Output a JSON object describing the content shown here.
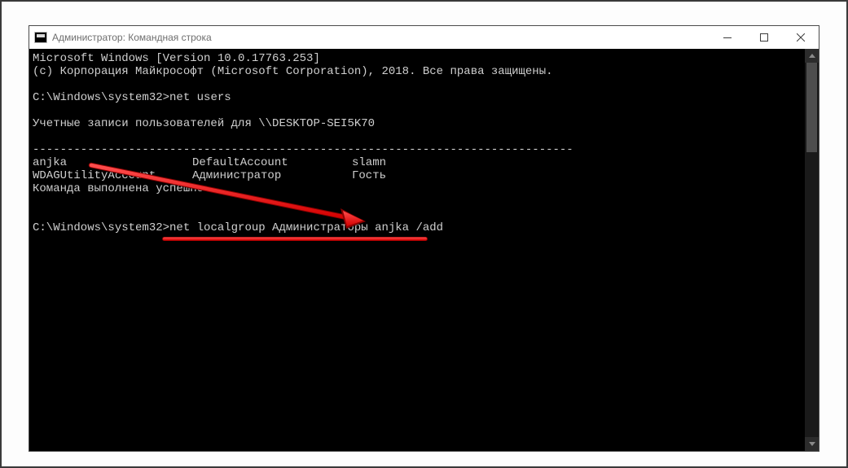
{
  "window": {
    "title": "Администратор: Командная строка"
  },
  "console": {
    "line1": "Microsoft Windows [Version 10.0.17763.253]",
    "line2": "(c) Корпорация Майкрософт (Microsoft Corporation), 2018. Все права защищены.",
    "prompt1_path": "C:\\Windows\\system32>",
    "prompt1_cmd": "net users",
    "accounts_header": "Учетные записи пользователей для \\\\DESKTOP-SEI5K70",
    "dashes": "-------------------------------------------------------------------------------",
    "row1_c1": "anjka",
    "row1_c2": "DefaultAccount",
    "row1_c3": "slamn",
    "row2_c1": "WDAGUtilityAccount",
    "row2_c2": "Администратор",
    "row2_c3": "Гость",
    "done": "Команда выполнена успешно.",
    "prompt2_path": "C:\\Windows\\system32>",
    "prompt2_cmd": "net localgroup Администраторы anjka /add"
  }
}
